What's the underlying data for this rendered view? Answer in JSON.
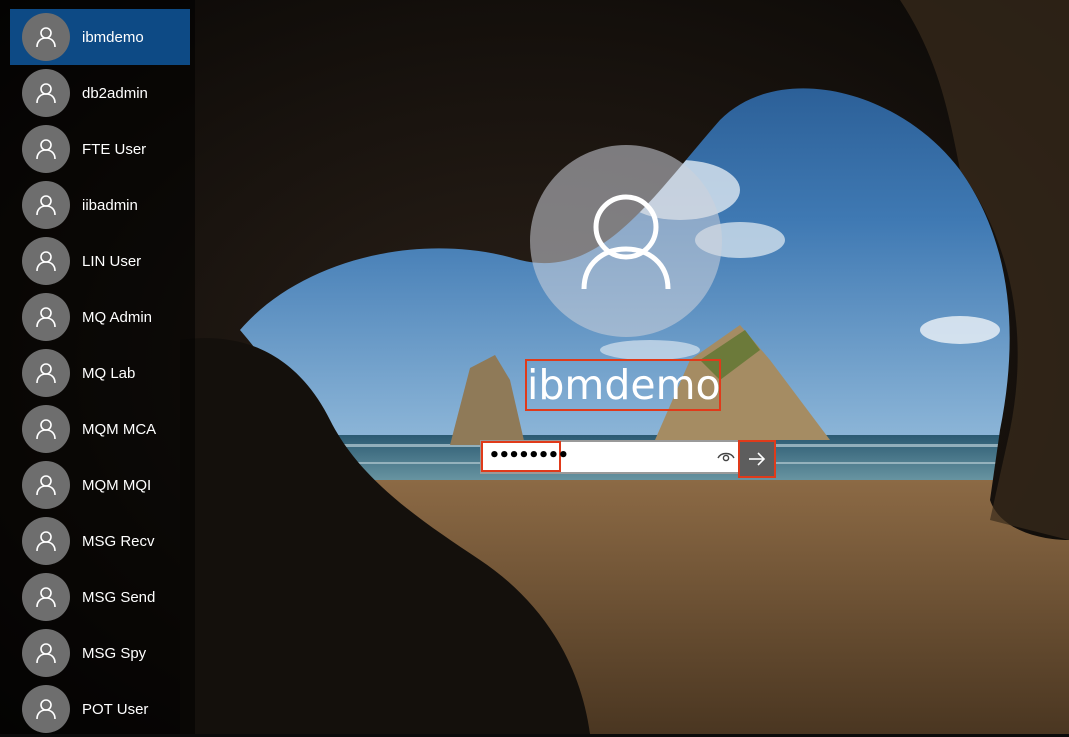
{
  "users": [
    {
      "name": "ibmdemo",
      "selected": true
    },
    {
      "name": "db2admin"
    },
    {
      "name": "FTE User"
    },
    {
      "name": "iibadmin"
    },
    {
      "name": "LIN User"
    },
    {
      "name": "MQ Admin"
    },
    {
      "name": "MQ Lab"
    },
    {
      "name": "MQM MCA"
    },
    {
      "name": "MQM MQI"
    },
    {
      "name": "MSG Recv"
    },
    {
      "name": "MSG Send"
    },
    {
      "name": "MSG Spy"
    },
    {
      "name": "POT User"
    }
  ],
  "login": {
    "username": "ibmdemo",
    "password_masked": "••••••••",
    "submit_icon": "arrow-right-icon",
    "reveal_icon": "eye-icon"
  },
  "colors": {
    "selected": "#0d4a85",
    "highlight": "#e03a1a",
    "avatar_bg": "#6e6e6e"
  }
}
